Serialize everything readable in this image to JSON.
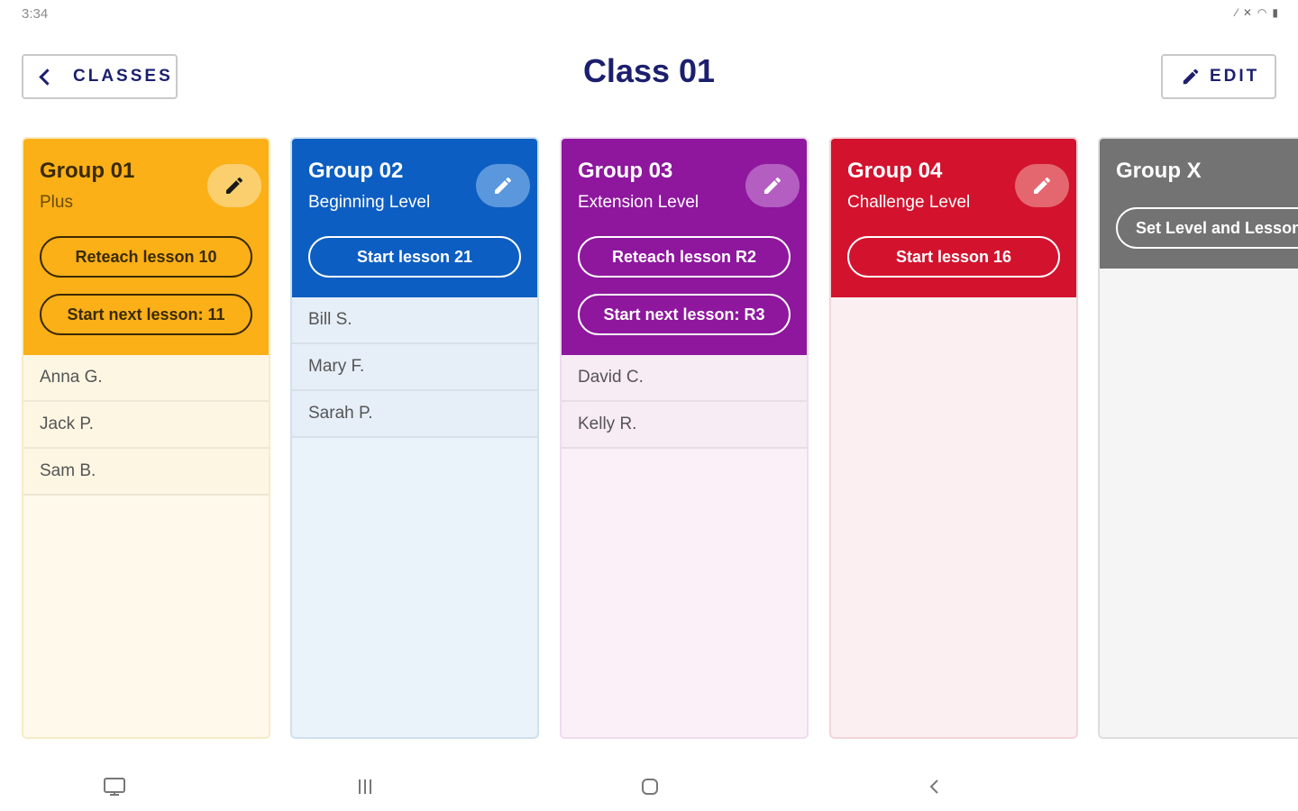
{
  "status_bar": {
    "time": "3:34"
  },
  "header": {
    "back_label": "CLASSES",
    "title": "Class 01",
    "edit_label": "EDIT"
  },
  "groups": [
    {
      "title": "Group 01",
      "subtitle": "Plus",
      "actions": [
        "Reteach lesson 10",
        "Start next lesson: 11"
      ],
      "students": [
        "Anna  G.",
        "Jack  P.",
        "Sam B."
      ],
      "color": "#fbb018"
    },
    {
      "title": "Group 02",
      "subtitle": "Beginning Level",
      "actions": [
        "Start lesson 21"
      ],
      "students": [
        "Bill S.",
        "Mary F.",
        "Sarah P."
      ],
      "color": "#0d5ec2"
    },
    {
      "title": "Group 03",
      "subtitle": "Extension Level",
      "actions": [
        "Reteach lesson R2",
        "Start next lesson: R3"
      ],
      "students": [
        "David C.",
        "Kelly  R."
      ],
      "color": "#8e179e"
    },
    {
      "title": "Group 04",
      "subtitle": "Challenge Level",
      "actions": [
        "Start lesson 16"
      ],
      "students": [],
      "color": "#d3132e"
    },
    {
      "title": "Group X",
      "actions": [
        "Set Level and Lesson"
      ],
      "color": "#737373"
    }
  ],
  "nav_bar": {
    "icons": [
      "screenshot-icon",
      "recent-apps-icon",
      "home-icon",
      "back-icon"
    ]
  }
}
